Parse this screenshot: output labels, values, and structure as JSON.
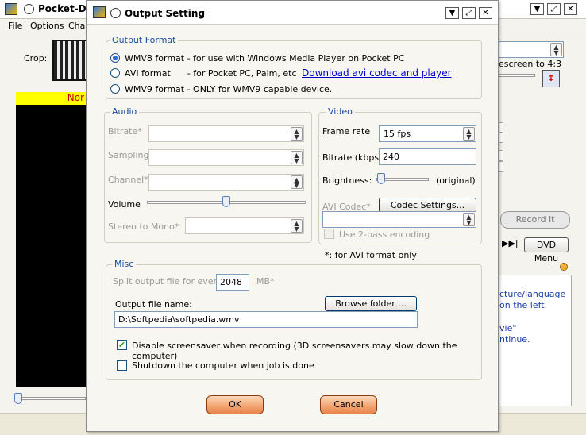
{
  "bg_window": {
    "title": "Pocket-DV",
    "menu": [
      "File",
      "Options",
      "Chap"
    ],
    "crop_label": "Crop:",
    "banner_text": "Nor",
    "aspect_label": "escreen to 4:3",
    "record_label": "Record it",
    "dvd_menu_label": "DVD Menu",
    "info_lines": [
      "cture/language",
      "on the left.",
      "vie\"",
      "ntinue."
    ]
  },
  "dialog": {
    "title": "Output Setting",
    "output_format": {
      "label": "Output Format",
      "options": [
        "WMV8 format - for use with Windows Media Player on Pocket PC",
        "AVI format      - for Pocket PC, Palm, etc",
        "WMV9 format - ONLY for WMV9 capable device."
      ],
      "selected_index": 0,
      "download_link": "Download avi codec and player"
    },
    "audio": {
      "label": "Audio",
      "bitrate": "Bitrate*",
      "sampling": "Sampling*",
      "channel": "Channel*",
      "volume": "Volume",
      "volume_level": 0.5,
      "stereo_to_mono": "Stereo to Mono*"
    },
    "video": {
      "label": "Video",
      "frame_rate_label": "Frame rate",
      "frame_rate_value": "15 fps",
      "bitrate_label": "Bitrate (kbps)",
      "bitrate_value": "240",
      "brightness_label": "Brightness:",
      "brightness_note": "(original)",
      "avi_codec_label": "AVI Codec*",
      "codec_settings_button": "Codec Settings...",
      "two_pass_label": "Use 2-pass encoding",
      "footnote": "*: for AVI format only"
    },
    "misc": {
      "label": "Misc",
      "split_label": "Split output file for every",
      "split_value": "2048",
      "split_unit": "MB*",
      "output_file_label": "Output file name:",
      "browse_button": "Browse folder  ...",
      "output_file_value": "D:\\Softpedia\\softpedia.wmv",
      "disable_screensaver": "Disable screensaver when recording (3D screensavers may slow down the computer)",
      "disable_screensaver_checked": true,
      "shutdown": "Shutdown the computer when job is done",
      "shutdown_checked": false
    },
    "ok_button": "OK",
    "cancel_button": "Cancel"
  }
}
